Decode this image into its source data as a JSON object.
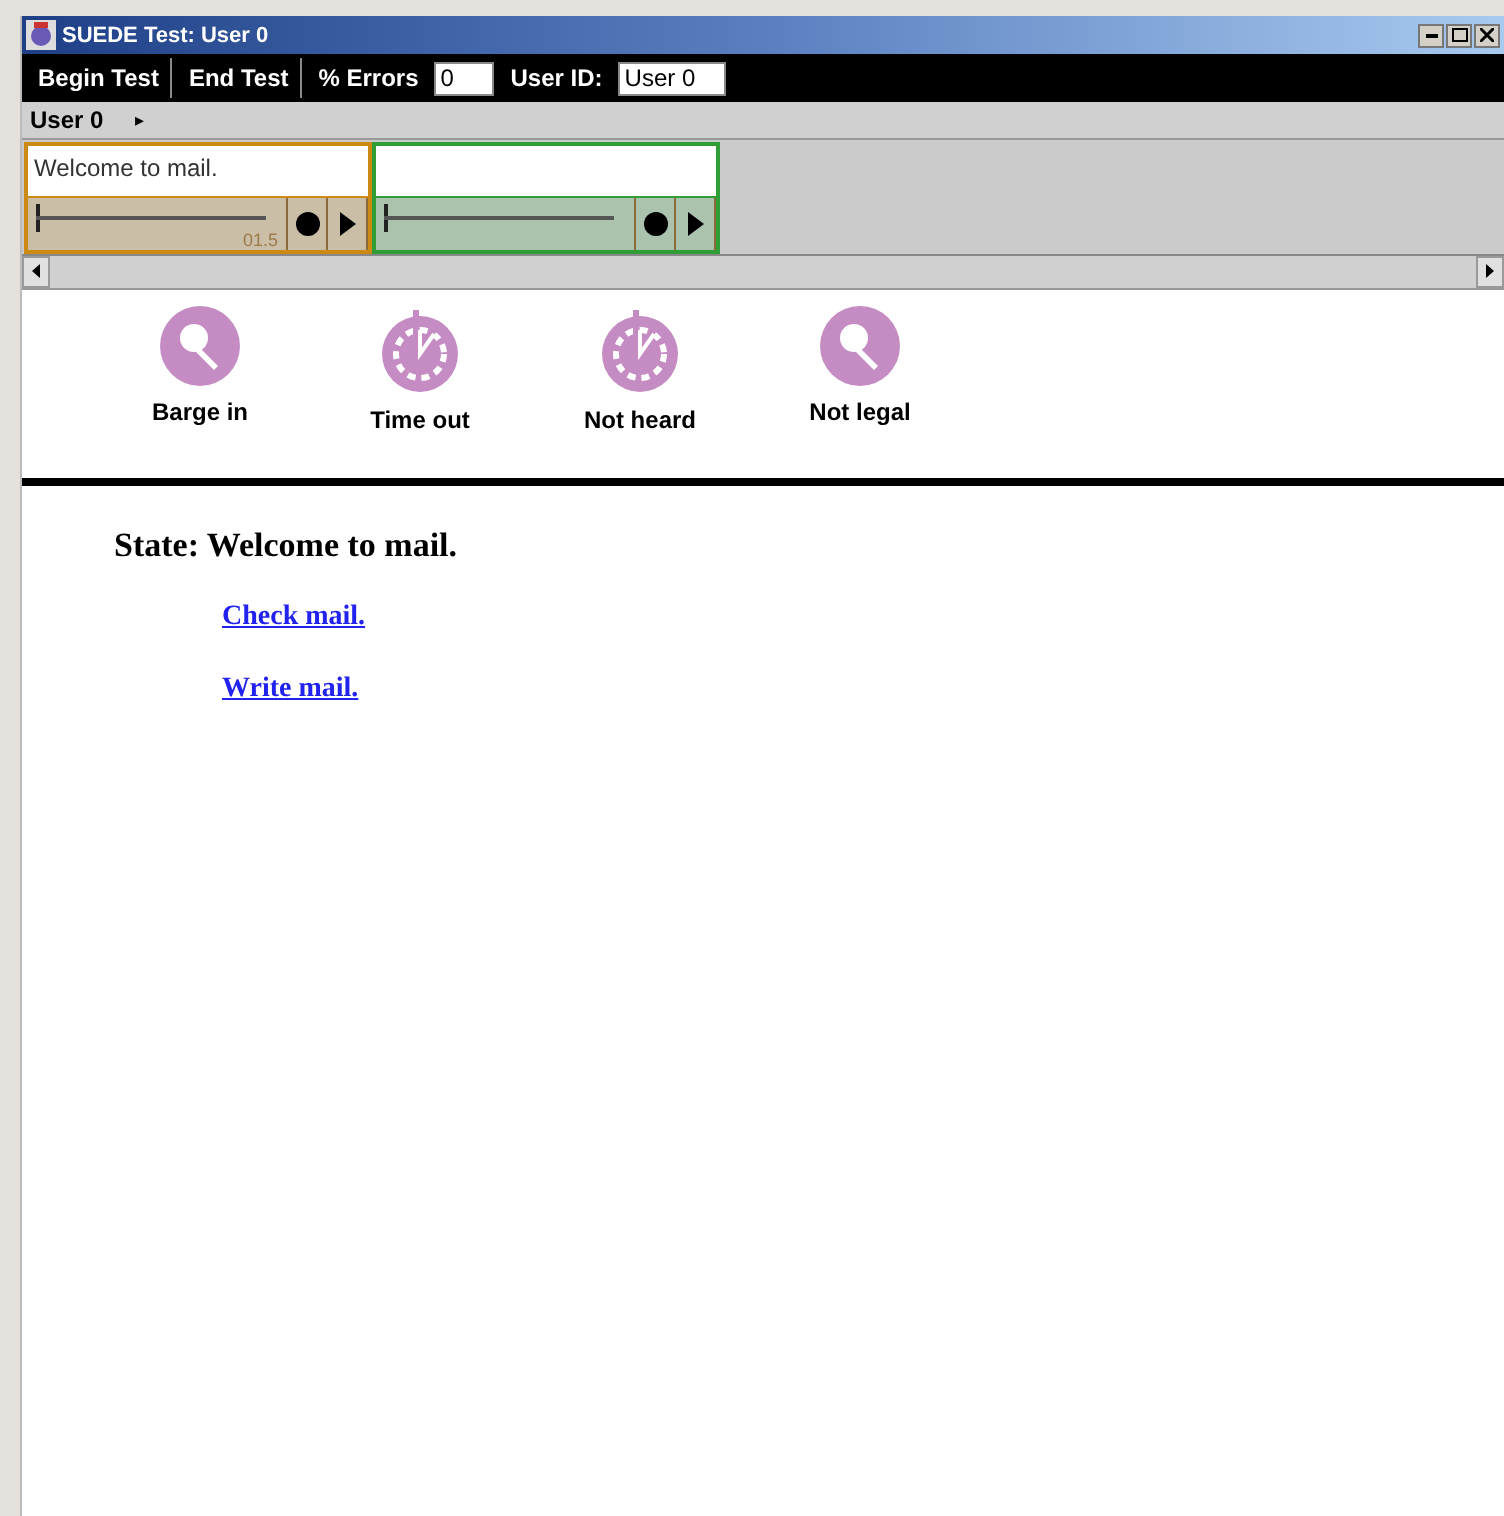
{
  "window": {
    "title": "SUEDE Test: User 0"
  },
  "toolbar": {
    "begin_button": "Begin Test",
    "end_button": "End Test",
    "errors_label": "% Errors",
    "errors_value": "0",
    "user_id_label": "User ID:",
    "user_id_value": "User 0"
  },
  "user_menu": {
    "label": "User 0",
    "arrow": "▸"
  },
  "cards": [
    {
      "text": "Welcome to mail.",
      "time": "01.5",
      "color": "#cc8a12"
    },
    {
      "color": "#2f9e36"
    }
  ],
  "events": [
    {
      "label": "Barge in",
      "kind": "microphone"
    },
    {
      "label": "Time out",
      "kind": "stopwatch"
    },
    {
      "label": "Not heard",
      "kind": "stopwatch"
    },
    {
      "label": "Not legal",
      "kind": "microphone"
    }
  ],
  "state": {
    "title": "State: Welcome to mail.",
    "links": [
      "Check mail.",
      "Write mail."
    ]
  }
}
